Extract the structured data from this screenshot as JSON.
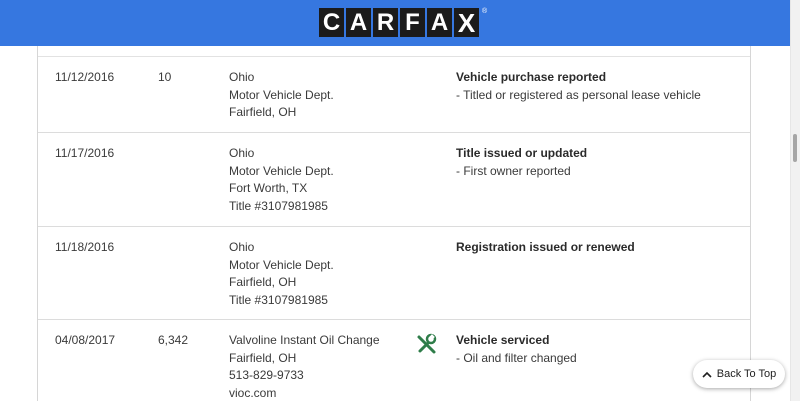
{
  "header": {
    "logo_letters": [
      "C",
      "A",
      "R",
      "F",
      "A",
      "X"
    ],
    "logo_registered": "®",
    "brand_color": "#3677e0"
  },
  "records": [
    {
      "date": "11/12/2016",
      "odometer": "10",
      "source": [
        "Ohio",
        "Motor Vehicle Dept.",
        "Fairfield, OH"
      ],
      "icon": "",
      "comment_heading": "Vehicle purchase reported",
      "comment_details": [
        "- Titled or registered as personal lease vehicle"
      ]
    },
    {
      "date": "11/17/2016",
      "odometer": "",
      "source": [
        "Ohio",
        "Motor Vehicle Dept.",
        "Fort Worth, TX",
        "Title #3107981985"
      ],
      "icon": "",
      "comment_heading": "Title issued or updated",
      "comment_details": [
        "- First owner reported"
      ]
    },
    {
      "date": "11/18/2016",
      "odometer": "",
      "source": [
        "Ohio",
        "Motor Vehicle Dept.",
        "Fairfield, OH",
        "Title #3107981985"
      ],
      "icon": "",
      "comment_heading": "Registration issued or renewed",
      "comment_details": []
    },
    {
      "date": "04/08/2017",
      "odometer": "6,342",
      "source": [
        "Valvoline Instant Oil Change",
        "Fairfield, OH",
        "513-829-9733",
        "vioc.com"
      ],
      "icon": "wrench-screwdriver-icon",
      "comment_heading": "Vehicle serviced",
      "comment_details": [
        "- Oil and filter changed"
      ]
    }
  ],
  "back_to_top": {
    "label": "Back To Top",
    "icon": "chevron-up-icon"
  }
}
